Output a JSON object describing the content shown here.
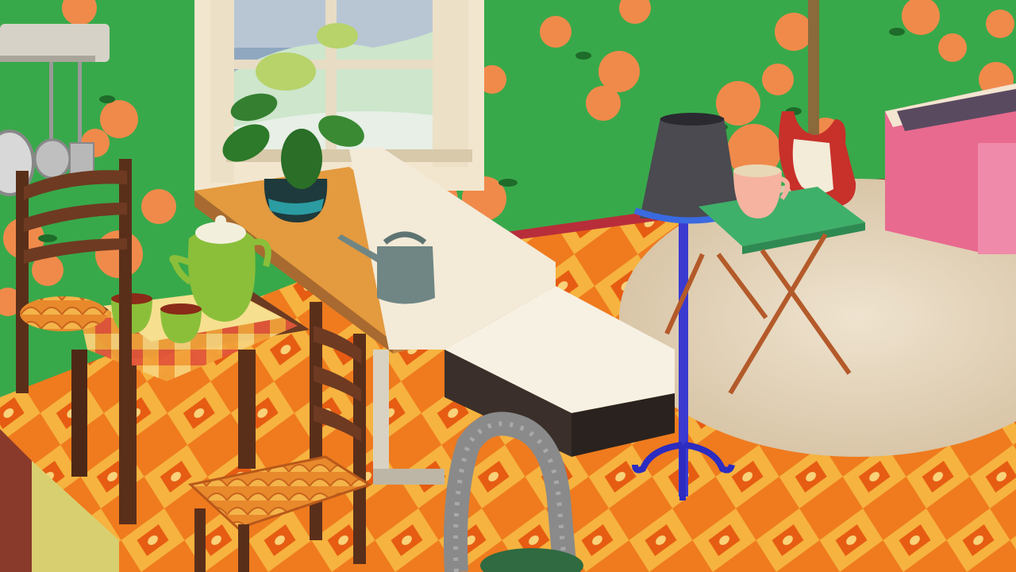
{
  "scene": {
    "type": "game-interior",
    "objects": [
      "floral-wallpaper",
      "window",
      "potted-anthurium-plant",
      "wooden-counter-table",
      "watering-can",
      "white-booth-sofa",
      "floor-lamp",
      "folding-tray-table",
      "teacup",
      "electric-guitar",
      "record-crate",
      "shaggy-round-rug",
      "kitchen-utensil-rack",
      "ladder-back-chair",
      "small-dining-table",
      "green-teapot",
      "green-cups",
      "vacuum-cleaner-hose",
      "patterned-orange-floor"
    ],
    "colors": {
      "wallpaper": "#34a345",
      "rose": "#f08a4b",
      "floor": "#ef7b1e",
      "floor_pattern": "#f6b33f",
      "wood": "#6b3a22",
      "counter_top": "#e49a3e",
      "lamp_pole": "#3a3ad0",
      "lamp_shade": "#4a4a50",
      "tray_table": "#3fb06a",
      "rug": "#e8d8c0",
      "baseboard": "#b82d3a",
      "crate": "#e86a8f"
    }
  }
}
